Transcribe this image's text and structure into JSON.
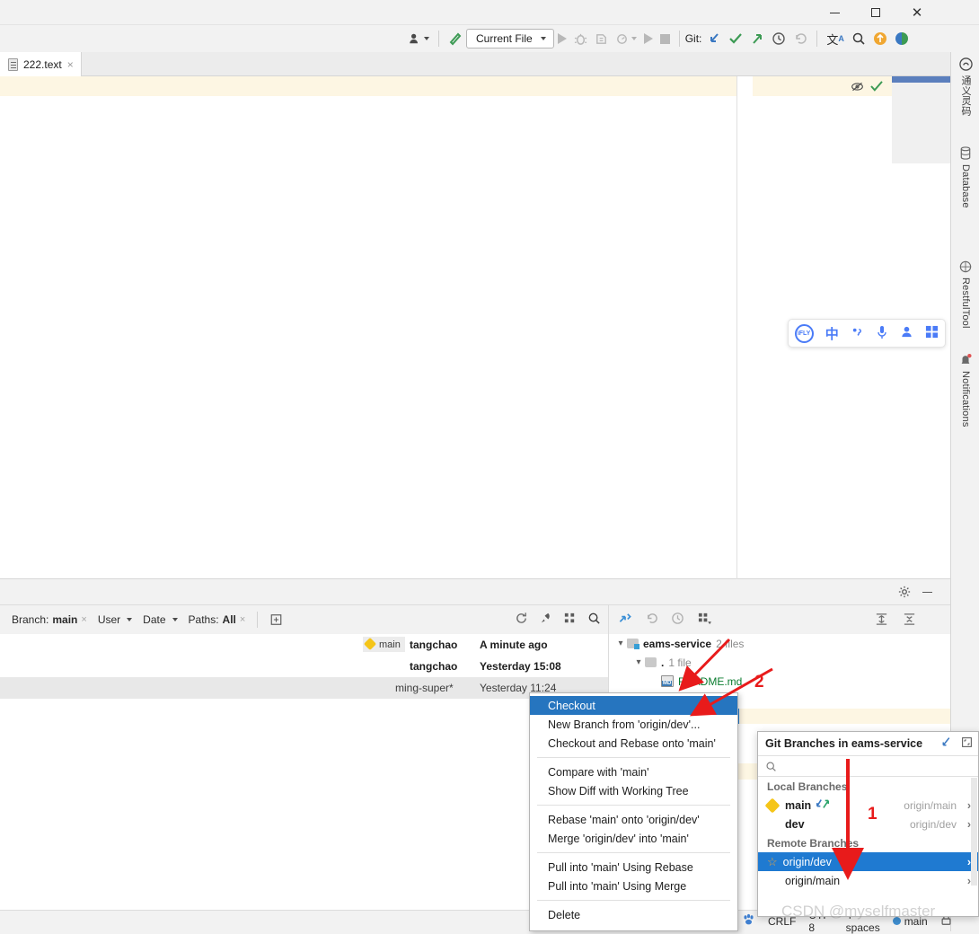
{
  "window": {
    "minimize_label": "—",
    "maximize_label": "□",
    "close_label": "✕"
  },
  "toolbar": {
    "run_config_label": "Current File",
    "git_label": "Git:",
    "icons": [
      "user-avatar-icon",
      "build-hammer-icon",
      "run-icon",
      "debug-icon",
      "run-coverage-icon",
      "profile-icon",
      "run-alt-icon",
      "stop-icon",
      "git-pull-icon",
      "git-commit-icon",
      "git-push-icon",
      "history-icon",
      "rollback-icon",
      "translate-icon",
      "search-everywhere-icon",
      "update-icon",
      "ai-assistant-icon"
    ]
  },
  "tabs": {
    "active_tab": "222.text",
    "close_label": "×",
    "options_label": "⋮"
  },
  "right_stripe": {
    "items": [
      {
        "label": "通义灵码",
        "icon": "tongyi-icon"
      },
      {
        "label": "Database",
        "icon": "database-icon"
      },
      {
        "label": "RestfulTool",
        "icon": "restful-icon"
      },
      {
        "label": "Notifications",
        "icon": "bell-icon"
      }
    ]
  },
  "ime": {
    "logo": "iFLY",
    "chinese_mode": "中",
    "punctuation": "。，",
    "mic": "mic-icon",
    "user": "user-icon",
    "apps": "apps-icon"
  },
  "git_window": {
    "filters": {
      "branch_label": "Branch:",
      "branch_value": "main",
      "user_label": "User",
      "date_label": "Date",
      "paths_label": "Paths:",
      "paths_value": "All",
      "clear_label": "×"
    },
    "commits": [
      {
        "tag": "main",
        "author": "tangchao",
        "date": "A minute ago",
        "bold": true,
        "selected": false
      },
      {
        "tag": "",
        "author": "tangchao",
        "date": "Yesterday 15:08",
        "bold": true,
        "selected": false
      },
      {
        "tag": "",
        "author": "ming-super*",
        "date": "Yesterday 11:24",
        "bold": false,
        "selected": true
      }
    ],
    "changed_files": {
      "root_label": "eams-service",
      "root_count": "2 files",
      "child_label": ".",
      "child_count": "1 file",
      "file_label": "README.md"
    }
  },
  "context_menu": {
    "items": [
      {
        "label": "Checkout",
        "selected": true
      },
      {
        "label": "New Branch from 'origin/dev'...",
        "selected": false
      },
      {
        "label": "Checkout and Rebase onto 'main'",
        "selected": false
      },
      {
        "divider": true
      },
      {
        "label": "Compare with 'main'",
        "selected": false
      },
      {
        "label": "Show Diff with Working Tree",
        "selected": false
      },
      {
        "divider": true
      },
      {
        "label": "Rebase 'main' onto 'origin/dev'",
        "selected": false
      },
      {
        "label": "Merge 'origin/dev' into 'main'",
        "selected": false
      },
      {
        "divider": true
      },
      {
        "label": "Pull into 'main' Using Rebase",
        "selected": false
      },
      {
        "label": "Pull into 'main' Using Merge",
        "selected": false
      },
      {
        "divider": true
      },
      {
        "label": "Delete",
        "selected": false
      }
    ]
  },
  "branch_popup": {
    "title": "Git Branches in eams-service",
    "search_placeholder": "",
    "search_value": "",
    "local_header": "Local Branches",
    "remote_header": "Remote Branches",
    "local": [
      {
        "name": "main",
        "tracking": "origin/main",
        "current": true,
        "selected": false
      },
      {
        "name": "dev",
        "tracking": "origin/dev",
        "current": false,
        "selected": false
      }
    ],
    "remote": [
      {
        "name": "origin/dev",
        "tracking": "",
        "favorite": true,
        "selected": true
      },
      {
        "name": "origin/main",
        "tracking": "",
        "favorite": false,
        "selected": false
      }
    ]
  },
  "status_bar": {
    "line_separator": "CRLF",
    "encoding": "UTF-8",
    "indent": "4 spaces",
    "branch": "main",
    "lock_icon": "lock-icon"
  },
  "annotations": {
    "one": "1",
    "two": "2"
  },
  "watermark": {
    "text": "CSDN @myselfmaster"
  },
  "colors": {
    "selection_blue": "#1f7ad1",
    "menu_blue": "#2675bf",
    "annotation_red": "#e81b1b",
    "caret_line": "#fdf6e3",
    "green": "#59a869"
  }
}
